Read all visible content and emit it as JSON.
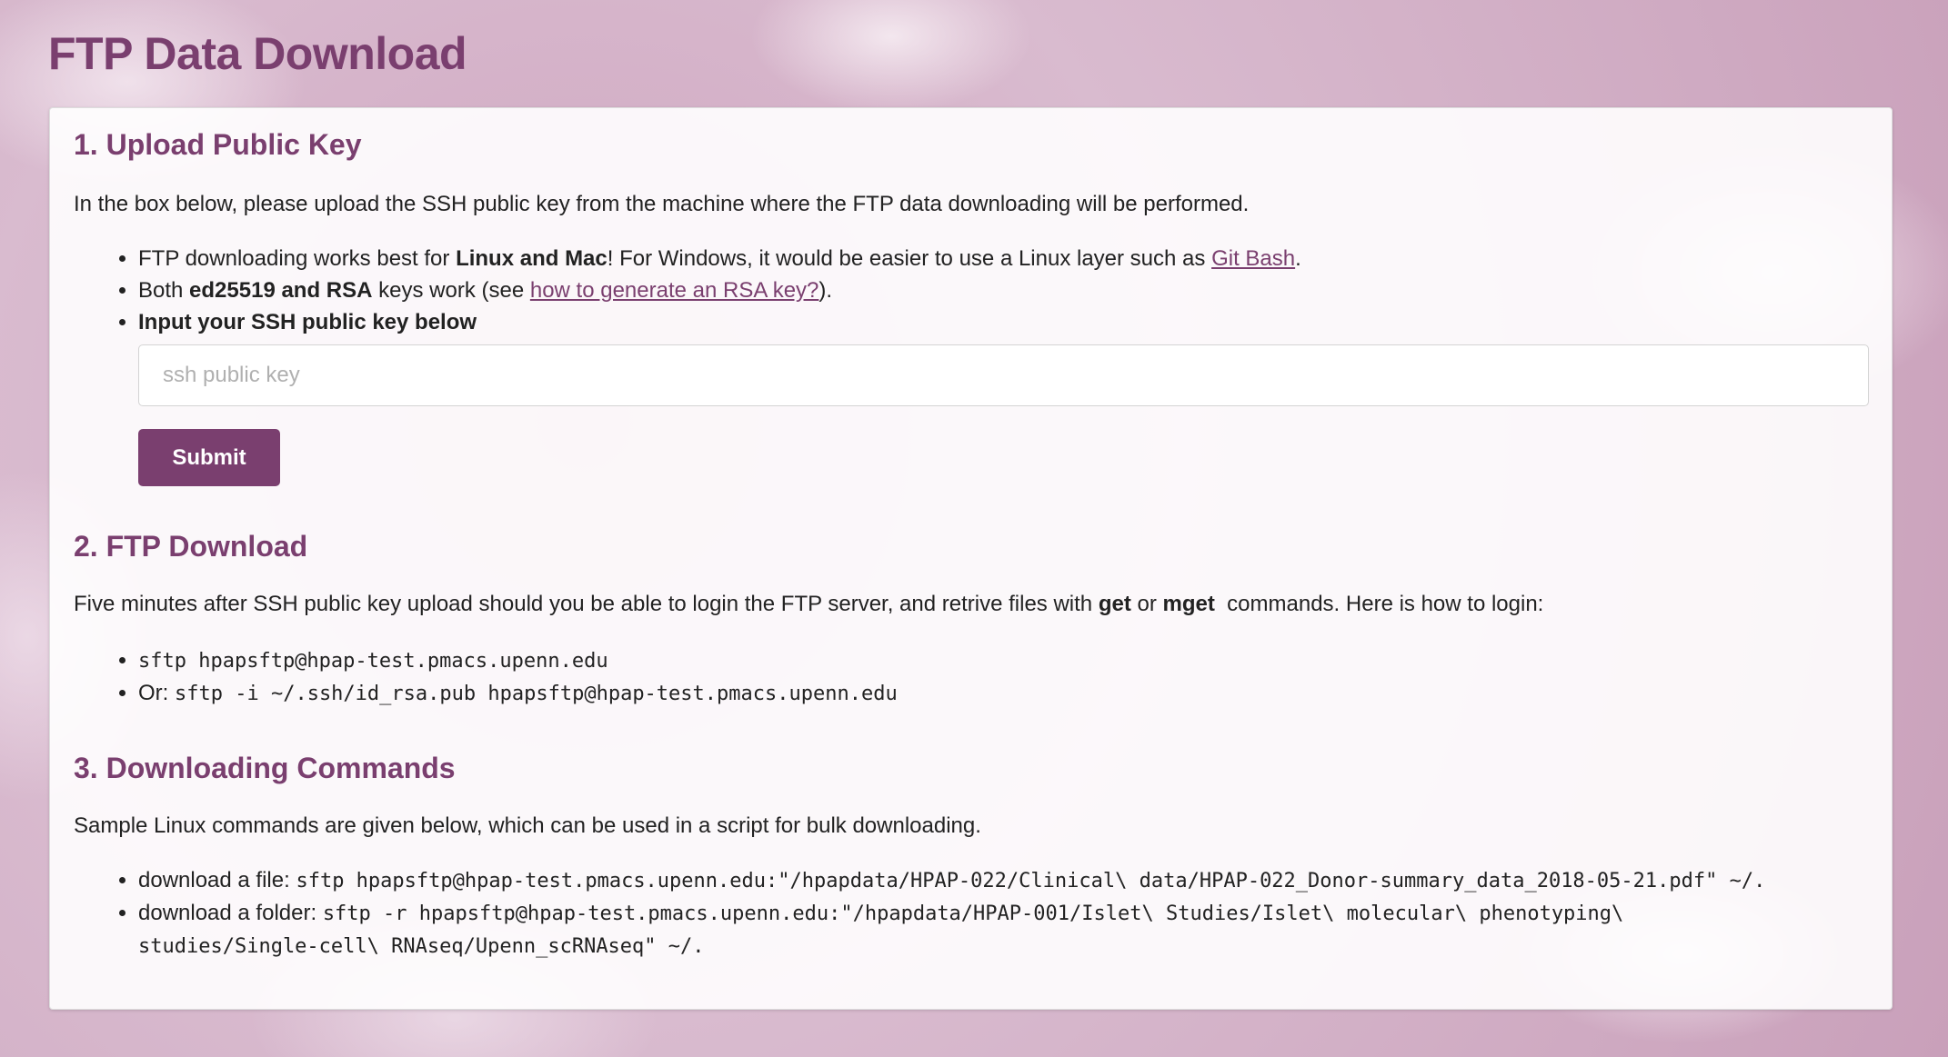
{
  "page_title": "FTP Data Download",
  "section1": {
    "heading": "1. Upload Public Key",
    "intro": "In the box below, please upload the SSH public key from the machine where the FTP data downloading will be performed.",
    "bullet1": {
      "pre": "FTP downloading works best for ",
      "bold": "Linux and Mac",
      "mid": "! For Windows, it would be easier to use a Linux layer such as ",
      "link": "Git Bash",
      "post": "."
    },
    "bullet2": {
      "pre": "Both ",
      "bold": "ed25519 and RSA",
      "mid": " keys work (see ",
      "link": "how to generate an RSA key?",
      "post": ")."
    },
    "bullet3": "Input your SSH public key below",
    "input_placeholder": "ssh public key",
    "input_value": "",
    "submit_label": "Submit"
  },
  "section2": {
    "heading": "2. FTP Download",
    "intro_pre": "Five minutes after SSH public key upload should you be able to login the FTP server, and retrive files with ",
    "get": "get",
    "or": " or ",
    "mget": "mget",
    "intro_post": "  commands. Here is how to login:",
    "cmd1": "sftp hpapsftp@hpap-test.pmacs.upenn.edu",
    "cmd2_prefix": "Or: ",
    "cmd2": "sftp -i ~/.ssh/id_rsa.pub hpapsftp@hpap-test.pmacs.upenn.edu"
  },
  "section3": {
    "heading": "3. Downloading Commands",
    "intro": "Sample Linux commands are given below, which can be used in a script for bulk downloading.",
    "file_prefix": "download a file: ",
    "file_cmd": "sftp hpapsftp@hpap-test.pmacs.upenn.edu:\"/hpapdata/HPAP-022/Clinical\\ data/HPAP-022_Donor-summary_data_2018-05-21.pdf\" ~/.",
    "folder_prefix": "download a folder: ",
    "folder_cmd_line1": "sftp -r hpapsftp@hpap-test.pmacs.upenn.edu:\"/hpapdata/HPAP-001/Islet\\ Studies/Islet\\ molecular\\ phenotyping\\",
    "folder_cmd_line2": "studies/Single-cell\\ RNAseq/Upenn_scRNAseq\" ~/."
  },
  "colors": {
    "accent": "#7a3f6f",
    "text": "#222222"
  }
}
